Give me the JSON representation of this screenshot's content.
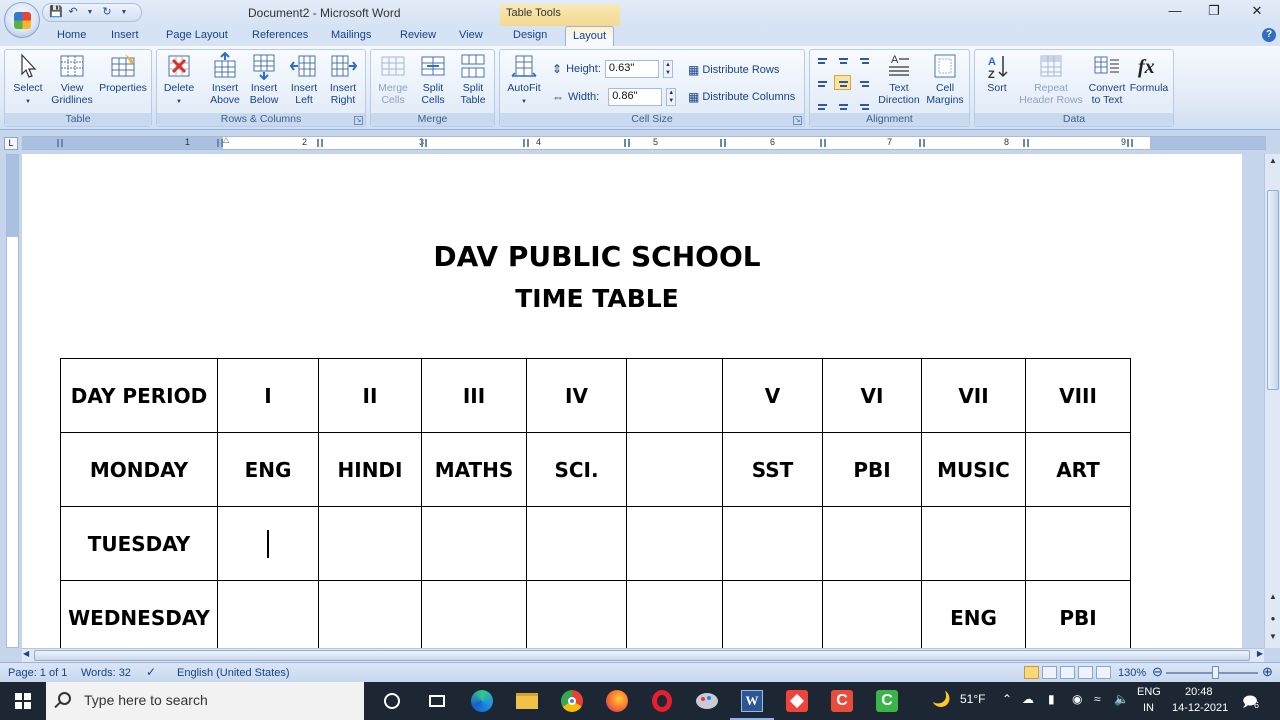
{
  "window": {
    "title": "Document2 - Microsoft Word",
    "context_tab_title": "Table Tools"
  },
  "tabs": [
    "Home",
    "Insert",
    "Page Layout",
    "References",
    "Mailings",
    "Review",
    "View",
    "Design",
    "Layout"
  ],
  "active_tab": "Layout",
  "ribbon": {
    "groups": {
      "table": "Table",
      "rows_columns": "Rows & Columns",
      "merge": "Merge",
      "cell_size": "Cell Size",
      "alignment": "Alignment",
      "data": "Data"
    },
    "buttons": {
      "select": "Select",
      "view_gridlines": "View\nGridlines",
      "properties": "Properties",
      "delete": "Delete",
      "insert_above": "Insert\nAbove",
      "insert_below": "Insert\nBelow",
      "insert_left": "Insert\nLeft",
      "insert_right": "Insert\nRight",
      "merge_cells": "Merge\nCells",
      "split_cells": "Split\nCells",
      "split_table": "Split\nTable",
      "autofit": "AutoFit",
      "text_direction": "Text\nDirection",
      "cell_margins": "Cell\nMargins",
      "sort": "Sort",
      "repeat_header_rows": "Repeat\nHeader Rows",
      "convert_to_text": "Convert\nto Text",
      "formula": "Formula"
    },
    "cell_size": {
      "height_label": "Height:",
      "height_value": "0.63\"",
      "width_label": "Width:",
      "width_value": "0.86\"",
      "distribute_rows": "Distribute Rows",
      "distribute_columns": "Distribute Columns"
    }
  },
  "ruler": {
    "numbers": [
      "1",
      "2",
      "3",
      "4",
      "5",
      "6",
      "7",
      "8",
      "9"
    ]
  },
  "document": {
    "heading1": "DAV PUBLIC SCHOOL",
    "heading2": "TIME TABLE",
    "table": [
      [
        "DAY PERIOD",
        "I",
        "II",
        "III",
        "IV",
        "",
        "V",
        "VI",
        "VII",
        "VIII"
      ],
      [
        "MONDAY",
        "ENG",
        "HINDI",
        "MATHS",
        "SCI.",
        "",
        "SST",
        "PBI",
        "MUSIC",
        "ART"
      ],
      [
        "TUESDAY",
        "",
        "",
        "",
        "",
        "",
        "",
        "",
        "",
        ""
      ],
      [
        "WEDNESDAY",
        "",
        "",
        "",
        "",
        "",
        "",
        "",
        "ENG",
        "PBI"
      ]
    ]
  },
  "statusbar": {
    "page": "Page: 1 of 1",
    "words": "Words: 32",
    "language": "English (United States)",
    "zoom": "130%"
  },
  "taskbar": {
    "search_placeholder": "Type here to search",
    "weather": "51°F",
    "lang_top": "ENG",
    "lang_bottom": "IN",
    "time": "20:48",
    "date": "14-12-2021",
    "notifications": "6"
  }
}
